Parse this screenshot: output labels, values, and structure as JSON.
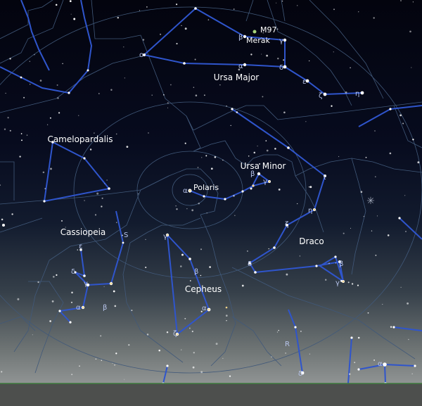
{
  "colors": {
    "boundary": "#41597a",
    "line": "#2f55cc",
    "star": "#ffffff",
    "label": "#ffffff",
    "greek": "#b9c6ee",
    "ground": "#4d4f4d",
    "horizon": "#3d7a3d",
    "deep_sky": "#a7d57a",
    "warm_star": "#ffd58a"
  },
  "constellations": [
    {
      "key": "ursa-major",
      "label": "Ursa Major"
    },
    {
      "key": "ursa-minor",
      "label": "Ursa Minor"
    },
    {
      "key": "camelopardalis",
      "label": "Camelopardalis"
    },
    {
      "key": "cassiopeia",
      "label": "Cassiopeia"
    },
    {
      "key": "cepheus",
      "label": "Cepheus"
    },
    {
      "key": "draco",
      "label": "Draco"
    }
  ],
  "named_objects": [
    {
      "key": "polaris",
      "label": "Polaris"
    },
    {
      "key": "merak",
      "label": "Merak"
    },
    {
      "key": "m97",
      "label": "M97"
    }
  ],
  "greek_labels": [
    {
      "key": "ursa-major-omicron",
      "text": "ο"
    },
    {
      "key": "ursa-major-beta",
      "text": "β"
    },
    {
      "key": "ursa-major-alpha",
      "text": "α"
    },
    {
      "key": "ursa-major-gamma",
      "text": "γ"
    },
    {
      "key": "ursa-major-delta",
      "text": "δ"
    },
    {
      "key": "ursa-major-epsilon",
      "text": "ε"
    },
    {
      "key": "ursa-major-zeta",
      "text": "ζ"
    },
    {
      "key": "ursa-major-eta",
      "text": "η"
    },
    {
      "key": "ursa-minor-alpha",
      "text": "α"
    },
    {
      "key": "ursa-minor-beta",
      "text": "β"
    },
    {
      "key": "ursa-minor-gamma",
      "text": "γ"
    },
    {
      "key": "draco-iota",
      "text": "ι"
    },
    {
      "key": "draco-eta",
      "text": "η"
    },
    {
      "key": "draco-zeta",
      "text": "ζ"
    },
    {
      "key": "draco-delta",
      "text": "δ"
    },
    {
      "key": "draco-beta",
      "text": "β"
    },
    {
      "key": "draco-gamma",
      "text": "γ"
    },
    {
      "key": "cepheus-gamma",
      "text": "γ"
    },
    {
      "key": "cepheus-beta",
      "text": "β"
    },
    {
      "key": "cepheus-alpha",
      "text": "α"
    },
    {
      "key": "cepheus-zeta",
      "text": "ζ"
    },
    {
      "key": "cassiopeia-epsilon",
      "text": "ε"
    },
    {
      "key": "cassiopeia-delta",
      "text": "δ"
    },
    {
      "key": "cassiopeia-gamma",
      "text": "γ"
    },
    {
      "key": "cassiopeia-alpha",
      "text": "α"
    },
    {
      "key": "cassiopeia-beta",
      "text": "β"
    },
    {
      "key": "lower-alpha",
      "text": "α"
    },
    {
      "key": "lower-delta",
      "text": "δ"
    },
    {
      "key": "variable-s",
      "text": "S"
    },
    {
      "key": "variable-r",
      "text": "R"
    }
  ]
}
